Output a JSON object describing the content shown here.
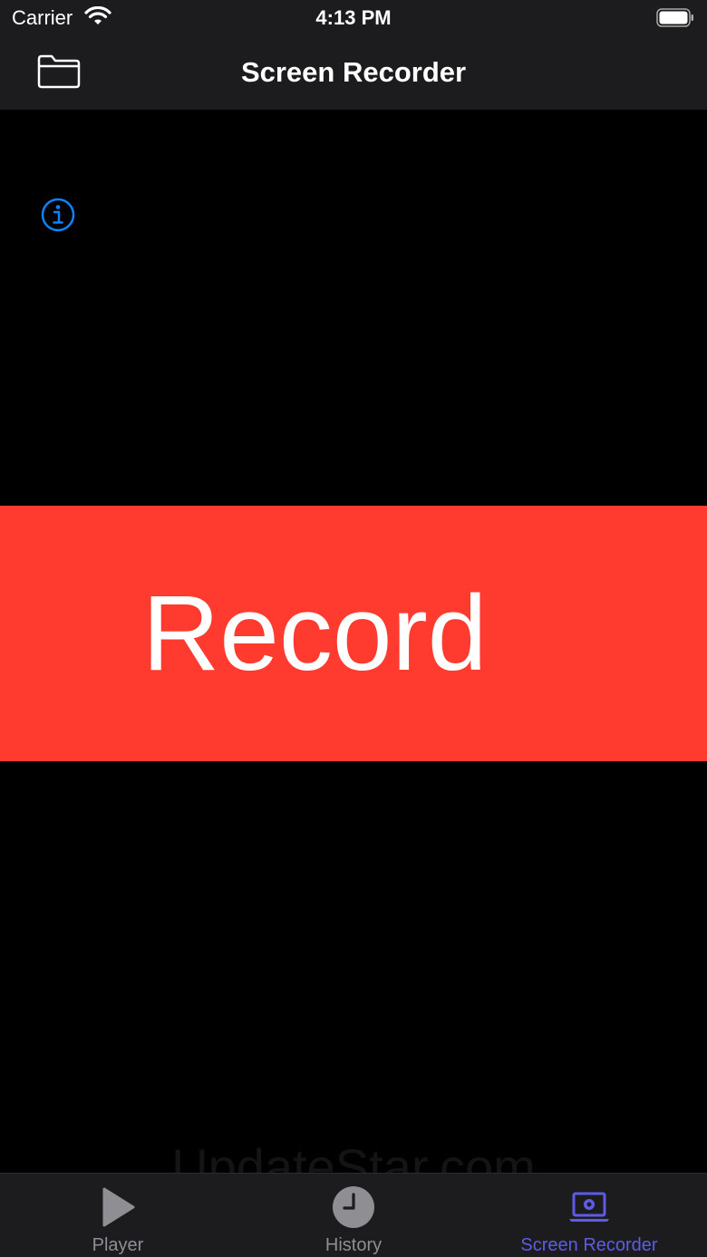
{
  "status_bar": {
    "carrier": "Carrier",
    "time": "4:13 PM"
  },
  "nav_bar": {
    "title": "Screen Recorder",
    "left_icon": "folder-icon"
  },
  "info_icon": "info-icon",
  "record_button": {
    "label": "Record",
    "color": "#ff3b30"
  },
  "watermark": "UpdateStar.com",
  "tab_bar": {
    "tabs": [
      {
        "label": "Player",
        "icon": "play-icon",
        "active": false
      },
      {
        "label": "History",
        "icon": "clock-icon",
        "active": false
      },
      {
        "label": "Screen Recorder",
        "icon": "screen-recorder-icon",
        "active": true
      }
    ],
    "active_color": "#5e5ce6",
    "inactive_color": "#8e8e93"
  }
}
